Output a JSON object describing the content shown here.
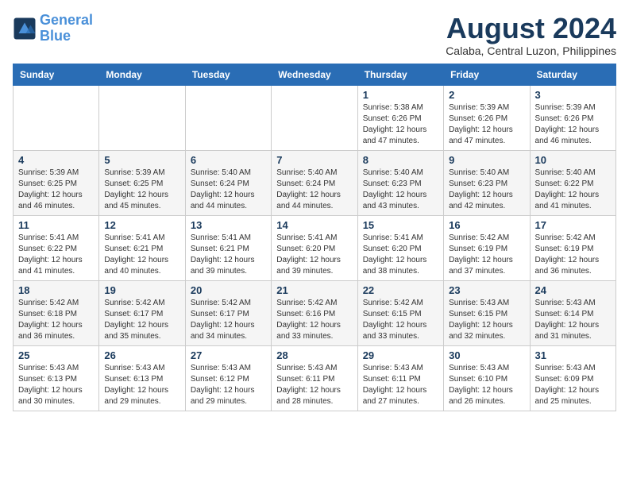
{
  "logo": {
    "line1": "General",
    "line2": "Blue"
  },
  "title": "August 2024",
  "subtitle": "Calaba, Central Luzon, Philippines",
  "days_of_week": [
    "Sunday",
    "Monday",
    "Tuesday",
    "Wednesday",
    "Thursday",
    "Friday",
    "Saturday"
  ],
  "weeks": [
    [
      {
        "day": "",
        "info": ""
      },
      {
        "day": "",
        "info": ""
      },
      {
        "day": "",
        "info": ""
      },
      {
        "day": "",
        "info": ""
      },
      {
        "day": "1",
        "info": "Sunrise: 5:38 AM\nSunset: 6:26 PM\nDaylight: 12 hours\nand 47 minutes."
      },
      {
        "day": "2",
        "info": "Sunrise: 5:39 AM\nSunset: 6:26 PM\nDaylight: 12 hours\nand 47 minutes."
      },
      {
        "day": "3",
        "info": "Sunrise: 5:39 AM\nSunset: 6:26 PM\nDaylight: 12 hours\nand 46 minutes."
      }
    ],
    [
      {
        "day": "4",
        "info": "Sunrise: 5:39 AM\nSunset: 6:25 PM\nDaylight: 12 hours\nand 46 minutes."
      },
      {
        "day": "5",
        "info": "Sunrise: 5:39 AM\nSunset: 6:25 PM\nDaylight: 12 hours\nand 45 minutes."
      },
      {
        "day": "6",
        "info": "Sunrise: 5:40 AM\nSunset: 6:24 PM\nDaylight: 12 hours\nand 44 minutes."
      },
      {
        "day": "7",
        "info": "Sunrise: 5:40 AM\nSunset: 6:24 PM\nDaylight: 12 hours\nand 44 minutes."
      },
      {
        "day": "8",
        "info": "Sunrise: 5:40 AM\nSunset: 6:23 PM\nDaylight: 12 hours\nand 43 minutes."
      },
      {
        "day": "9",
        "info": "Sunrise: 5:40 AM\nSunset: 6:23 PM\nDaylight: 12 hours\nand 42 minutes."
      },
      {
        "day": "10",
        "info": "Sunrise: 5:40 AM\nSunset: 6:22 PM\nDaylight: 12 hours\nand 41 minutes."
      }
    ],
    [
      {
        "day": "11",
        "info": "Sunrise: 5:41 AM\nSunset: 6:22 PM\nDaylight: 12 hours\nand 41 minutes."
      },
      {
        "day": "12",
        "info": "Sunrise: 5:41 AM\nSunset: 6:21 PM\nDaylight: 12 hours\nand 40 minutes."
      },
      {
        "day": "13",
        "info": "Sunrise: 5:41 AM\nSunset: 6:21 PM\nDaylight: 12 hours\nand 39 minutes."
      },
      {
        "day": "14",
        "info": "Sunrise: 5:41 AM\nSunset: 6:20 PM\nDaylight: 12 hours\nand 39 minutes."
      },
      {
        "day": "15",
        "info": "Sunrise: 5:41 AM\nSunset: 6:20 PM\nDaylight: 12 hours\nand 38 minutes."
      },
      {
        "day": "16",
        "info": "Sunrise: 5:42 AM\nSunset: 6:19 PM\nDaylight: 12 hours\nand 37 minutes."
      },
      {
        "day": "17",
        "info": "Sunrise: 5:42 AM\nSunset: 6:19 PM\nDaylight: 12 hours\nand 36 minutes."
      }
    ],
    [
      {
        "day": "18",
        "info": "Sunrise: 5:42 AM\nSunset: 6:18 PM\nDaylight: 12 hours\nand 36 minutes."
      },
      {
        "day": "19",
        "info": "Sunrise: 5:42 AM\nSunset: 6:17 PM\nDaylight: 12 hours\nand 35 minutes."
      },
      {
        "day": "20",
        "info": "Sunrise: 5:42 AM\nSunset: 6:17 PM\nDaylight: 12 hours\nand 34 minutes."
      },
      {
        "day": "21",
        "info": "Sunrise: 5:42 AM\nSunset: 6:16 PM\nDaylight: 12 hours\nand 33 minutes."
      },
      {
        "day": "22",
        "info": "Sunrise: 5:42 AM\nSunset: 6:15 PM\nDaylight: 12 hours\nand 33 minutes."
      },
      {
        "day": "23",
        "info": "Sunrise: 5:43 AM\nSunset: 6:15 PM\nDaylight: 12 hours\nand 32 minutes."
      },
      {
        "day": "24",
        "info": "Sunrise: 5:43 AM\nSunset: 6:14 PM\nDaylight: 12 hours\nand 31 minutes."
      }
    ],
    [
      {
        "day": "25",
        "info": "Sunrise: 5:43 AM\nSunset: 6:13 PM\nDaylight: 12 hours\nand 30 minutes."
      },
      {
        "day": "26",
        "info": "Sunrise: 5:43 AM\nSunset: 6:13 PM\nDaylight: 12 hours\nand 29 minutes."
      },
      {
        "day": "27",
        "info": "Sunrise: 5:43 AM\nSunset: 6:12 PM\nDaylight: 12 hours\nand 29 minutes."
      },
      {
        "day": "28",
        "info": "Sunrise: 5:43 AM\nSunset: 6:11 PM\nDaylight: 12 hours\nand 28 minutes."
      },
      {
        "day": "29",
        "info": "Sunrise: 5:43 AM\nSunset: 6:11 PM\nDaylight: 12 hours\nand 27 minutes."
      },
      {
        "day": "30",
        "info": "Sunrise: 5:43 AM\nSunset: 6:10 PM\nDaylight: 12 hours\nand 26 minutes."
      },
      {
        "day": "31",
        "info": "Sunrise: 5:43 AM\nSunset: 6:09 PM\nDaylight: 12 hours\nand 25 minutes."
      }
    ]
  ]
}
